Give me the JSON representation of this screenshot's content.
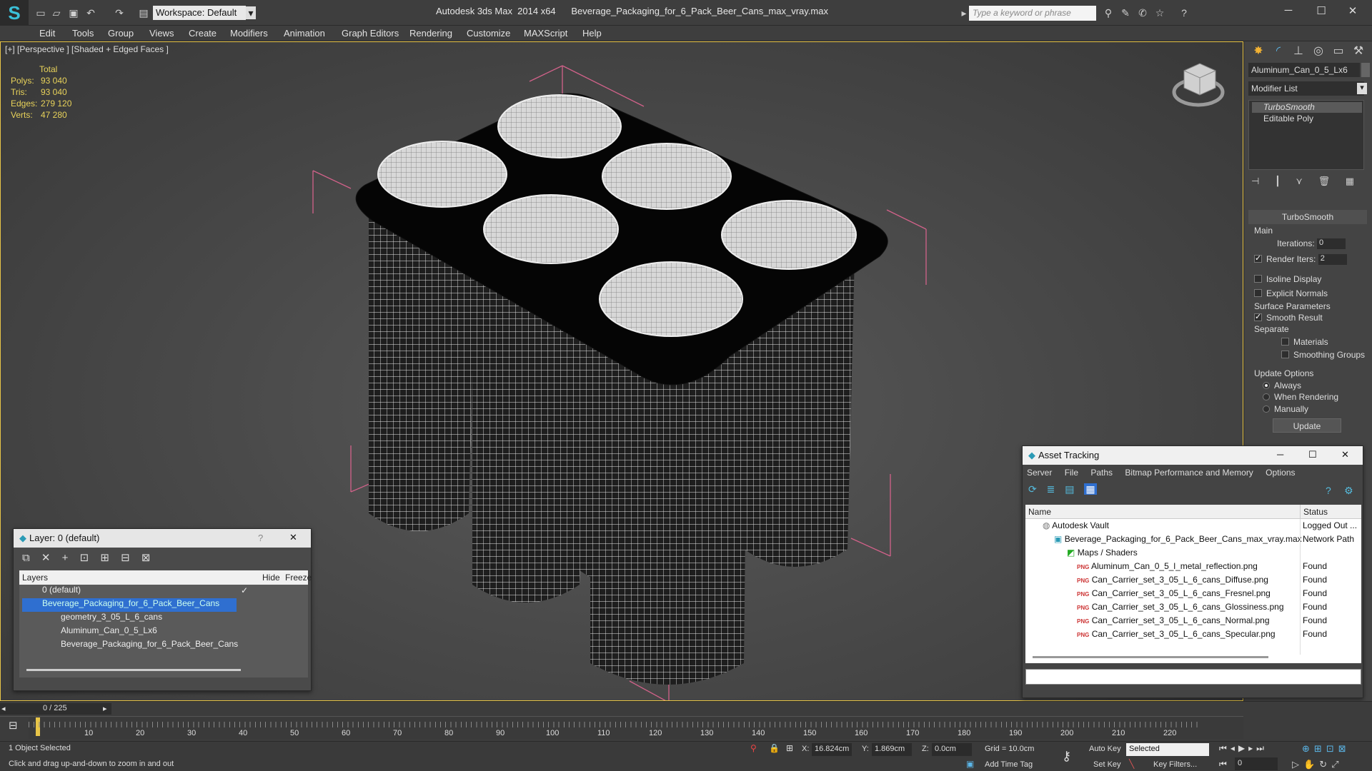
{
  "title_bar": {
    "workspace": "Workspace: Default",
    "app_title": "Autodesk 3ds Max  2014 x64",
    "file_name": "Beverage_Packaging_for_6_Pack_Beer_Cans_max_vray.max",
    "search_placeholder": "Type a keyword or phrase"
  },
  "menu": [
    "Edit",
    "Tools",
    "Group",
    "Views",
    "Create",
    "Modifiers",
    "Animation",
    "Graph Editors",
    "Rendering",
    "Customize",
    "MAXScript",
    "Help"
  ],
  "viewport": {
    "label": "[+] [Perspective ] [Shaded + Edged Faces ]",
    "stats_header": "Total",
    "stats": [
      {
        "label": "Polys:",
        "value": "93 040"
      },
      {
        "label": "Tris:",
        "value": "93 040"
      },
      {
        "label": "Edges:",
        "value": "279 120"
      },
      {
        "label": "Verts:",
        "value": "47 280"
      }
    ]
  },
  "command_panel": {
    "object_name": "Aluminum_Can_0_5_Lx6",
    "modifier_list": "Modifier List",
    "stack": [
      "TurboSmooth",
      "Editable Poly"
    ],
    "rollout_title": "TurboSmooth",
    "main_label": "Main",
    "iterations_label": "Iterations:",
    "iterations_value": "0",
    "render_iters_label": "Render Iters:",
    "render_iters_value": "2",
    "isoline": "Isoline Display",
    "explicit_normals": "Explicit Normals",
    "surface_params": "Surface Parameters",
    "smooth_result": "Smooth Result",
    "separate": "Separate",
    "materials": "Materials",
    "smoothing_groups": "Smoothing Groups",
    "update_options": "Update Options",
    "always": "Always",
    "when_rendering": "When Rendering",
    "manually": "Manually",
    "update_button": "Update"
  },
  "layer_window": {
    "title": "Layer: 0 (default)",
    "help": "?",
    "col_layers": "Layers",
    "col_hide": "Hide",
    "col_freeze": "Freeze",
    "rows": [
      "0 (default)",
      "Beverage_Packaging_for_6_Pack_Beer_Cans",
      "geometry_3_05_L_6_cans",
      "Aluminum_Can_0_5_Lx6",
      "Beverage_Packaging_for_6_Pack_Beer_Cans"
    ]
  },
  "asset_window": {
    "title": "Asset Tracking",
    "menu": [
      "Server",
      "File",
      "Paths",
      "Bitmap Performance and Memory",
      "Options"
    ],
    "col_name": "Name",
    "col_status": "Status",
    "rows": [
      {
        "name": "Autodesk Vault",
        "status": "Logged Out ..."
      },
      {
        "name": "Beverage_Packaging_for_6_Pack_Beer_Cans_max_vray.max",
        "status": "Network Path"
      },
      {
        "name": "Maps / Shaders",
        "status": ""
      },
      {
        "name": "Aluminum_Can_0_5_l_metal_reflection.png",
        "status": "Found"
      },
      {
        "name": "Can_Carrier_set_3_05_L_6_cans_Diffuse.png",
        "status": "Found"
      },
      {
        "name": "Can_Carrier_set_3_05_L_6_cans_Fresnel.png",
        "status": "Found"
      },
      {
        "name": "Can_Carrier_set_3_05_L_6_cans_Glossiness.png",
        "status": "Found"
      },
      {
        "name": "Can_Carrier_set_3_05_L_6_cans_Normal.png",
        "status": "Found"
      },
      {
        "name": "Can_Carrier_set_3_05_L_6_cans_Specular.png",
        "status": "Found"
      }
    ],
    "png_badge": "PNG"
  },
  "timeline": {
    "frame": "0 / 225",
    "ticks": [
      "10",
      "20",
      "30",
      "40",
      "50",
      "60",
      "70",
      "80",
      "90",
      "100",
      "110",
      "120",
      "130",
      "140",
      "150",
      "160",
      "170",
      "180",
      "190",
      "200",
      "210",
      "220"
    ]
  },
  "status": {
    "selected": "1 Object Selected",
    "hint": "Click and drag up-and-down to zoom in and out",
    "x_label": "X:",
    "x": "16.824cm",
    "y_label": "Y:",
    "y": "1.869cm",
    "z_label": "Z:",
    "z": "0.0cm",
    "grid": "Grid = 10.0cm",
    "auto_key": "Auto Key",
    "set_key": "Set Key",
    "selected_mode": "Selected",
    "key_filters": "Key Filters...",
    "add_time_tag": "Add Time Tag",
    "current_frame": "0"
  }
}
